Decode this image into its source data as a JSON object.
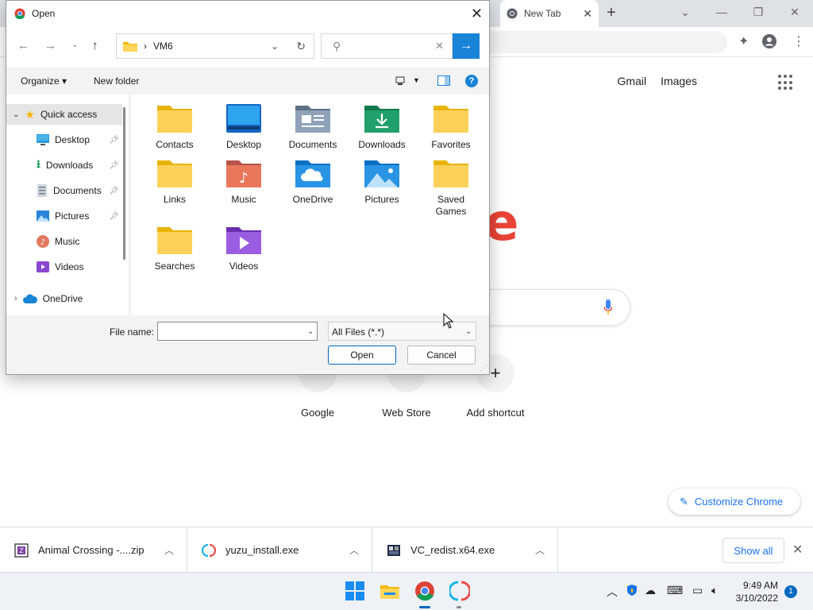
{
  "chrome": {
    "tab_title": "New Tab",
    "header_links": [
      "Gmail",
      "Images"
    ],
    "shortcuts": [
      "Google",
      "Web Store",
      "Add shortcut"
    ],
    "customize_label": "Customize Chrome",
    "logo_fragment": "e"
  },
  "downloads": {
    "items": [
      {
        "name": "Animal Crossing -....zip",
        "icon": "zip-icon"
      },
      {
        "name": "yuzu_install.exe",
        "icon": "yuzu-icon"
      },
      {
        "name": "VC_redist.x64.exe",
        "icon": "installer-icon"
      }
    ],
    "show_all_label": "Show all"
  },
  "dialog": {
    "title": "Open",
    "breadcrumb_separator": "›",
    "path": "VM6",
    "search_placeholder": "",
    "organize_label": "Organize ▾",
    "new_folder_label": "New folder",
    "nav": {
      "quick_access": "Quick access",
      "items": [
        "Desktop",
        "Downloads",
        "Documents",
        "Pictures",
        "Music",
        "Videos"
      ],
      "onedrive": "OneDrive"
    },
    "folders": [
      "Contacts",
      "Desktop",
      "Documents",
      "Downloads",
      "Favorites",
      "Links",
      "Music",
      "OneDrive",
      "Pictures",
      "Saved Games",
      "Searches",
      "Videos"
    ],
    "file_name_label": "File name:",
    "file_name_value": "",
    "file_type": "All Files (*.*)",
    "open_label": "Open",
    "cancel_label": "Cancel"
  },
  "taskbar": {
    "time": "9:49 AM",
    "date": "3/10/2022",
    "notification_count": "1"
  },
  "colors": {
    "accent": "#0067c0",
    "folder_yellow": "#f8c94a",
    "chrome_blue": "#1a73e8",
    "google_red": "#ea4335"
  }
}
